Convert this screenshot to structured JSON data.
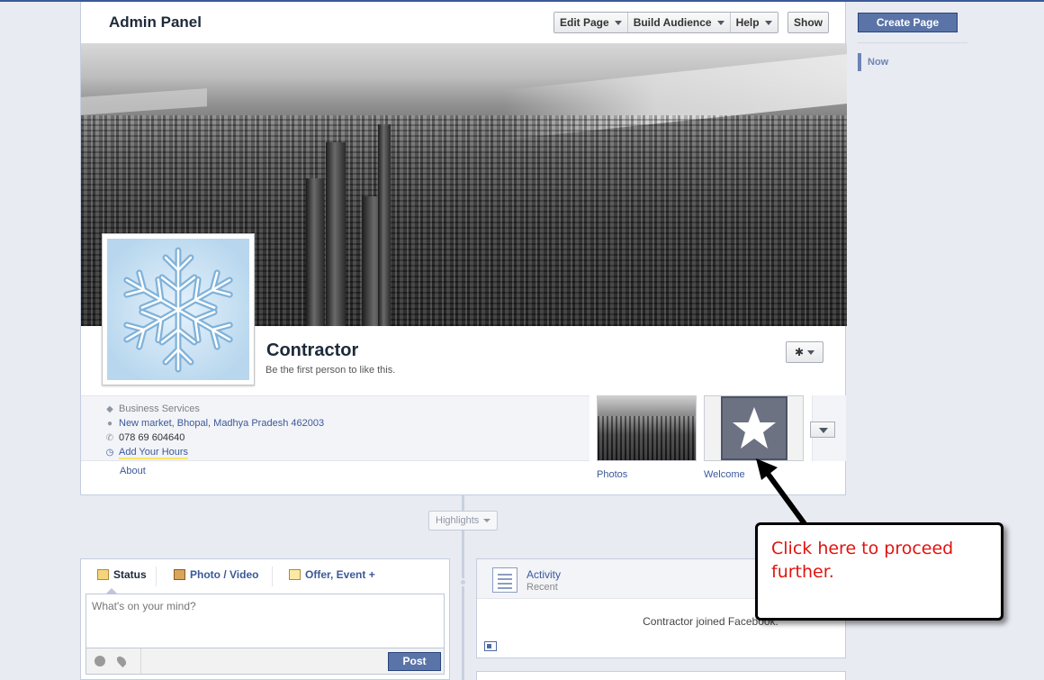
{
  "admin_bar": {
    "title": "Admin Panel",
    "edit_page": "Edit Page",
    "build_audience": "Build Audience",
    "help": "Help",
    "show": "Show"
  },
  "page": {
    "name": "Contractor",
    "subtitle": "Be the first person to like this."
  },
  "info": {
    "category": "Business Services",
    "address": "New market, Bhopal, Madhya Pradesh 462003",
    "phone": "078 69 604640",
    "hours_link": "Add Your Hours",
    "about": "About"
  },
  "apps": [
    {
      "label": "Photos"
    },
    {
      "label": "Welcome"
    }
  ],
  "timeline": {
    "highlights": "Highlights"
  },
  "composer": {
    "tabs": [
      "Status",
      "Photo / Video",
      "Offer, Event +"
    ],
    "placeholder": "What's on your mind?",
    "post": "Post"
  },
  "activity": {
    "title": "Activity",
    "subtitle": "Recent",
    "entry": "Contractor joined Facebook."
  },
  "sidebar": {
    "create_page": "Create Page",
    "now": "Now"
  },
  "callout": {
    "text": "Click here to proceed further."
  },
  "colors": {
    "brand": "#3b5998",
    "button_blue": "#5b74a8",
    "callout_text": "#e0140f"
  },
  "icons": [
    "tag-icon",
    "location-pin-icon",
    "phone-icon",
    "clock-icon",
    "gear-icon",
    "star-icon",
    "snowflake-icon",
    "activity-icon"
  ]
}
